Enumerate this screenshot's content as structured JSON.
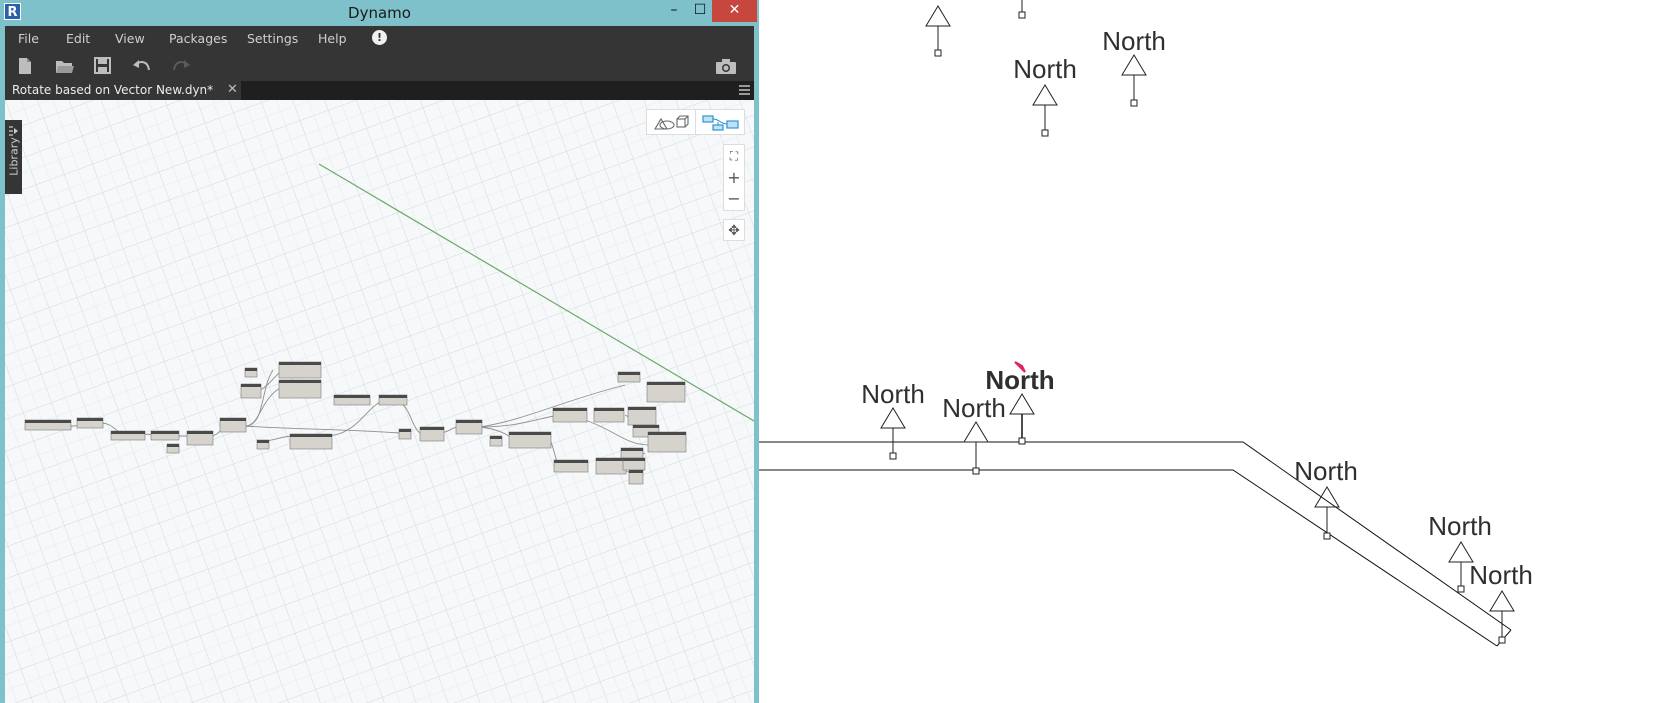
{
  "dynamo": {
    "app_icon_letter": "R",
    "window_title": "Dynamo",
    "window_controls": [
      "–",
      "☐",
      "✕"
    ],
    "menu": [
      "File",
      "Edit",
      "View",
      "Packages",
      "Settings",
      "Help"
    ],
    "alert_icon": "!",
    "toolbar_icons": [
      "new-file-icon",
      "open-file-icon",
      "save-icon",
      "undo-icon",
      "redo-icon",
      "camera-icon"
    ],
    "tab": {
      "label": "Rotate based on Vector New.dyn*",
      "close": "✕"
    },
    "library_label": "Library",
    "zoom_controls": [
      "⛶",
      "+",
      "−"
    ],
    "pan_icon": "✥"
  },
  "revit": {
    "marker_text": "North",
    "highlight_color": "#e0245e"
  }
}
